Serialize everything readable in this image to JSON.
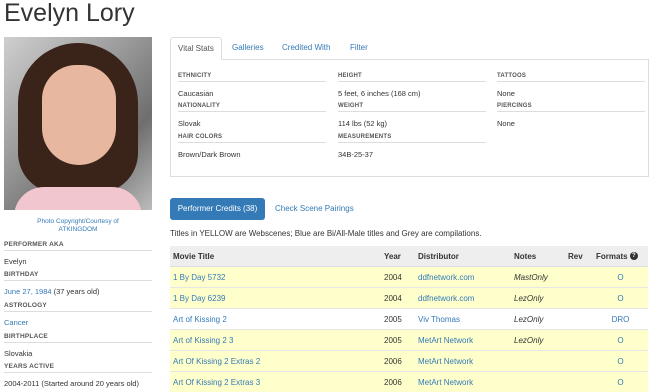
{
  "performer": {
    "name": "Evelyn Lory",
    "photo_credit_line1": "Photo Copyright/Courtesy of",
    "photo_credit_line2": "ATKINGDOM"
  },
  "sidebar": {
    "aka_label": "PERFORMER AKA",
    "aka_value": "Evelyn",
    "birthday_label": "BIRTHDAY",
    "birthday_date": "June 27, 1984",
    "birthday_age": " (37 years old)",
    "astrology_label": "ASTROLOGY",
    "astrology_value": "Cancer",
    "birthplace_label": "BIRTHPLACE",
    "birthplace_value": "Slovakia",
    "years_label": "YEARS ACTIVE",
    "years_value": "2004-2011 (Started around 20 years old)"
  },
  "tabs": [
    "Vital Stats",
    "Galleries",
    "Credited With",
    "Filter"
  ],
  "stats": {
    "ethnicity_label": "ETHNICITY",
    "ethnicity": "Caucasian",
    "nationality_label": "NATIONALITY",
    "nationality": "Slovak",
    "hair_label": "HAIR COLORS",
    "hair": "Brown/Dark Brown",
    "height_label": "HEIGHT",
    "height": "5 feet, 6 inches (168 cm)",
    "weight_label": "WEIGHT",
    "weight": "114 lbs (52 kg)",
    "measurements_label": "MEASUREMENTS",
    "measurements": "34B-25-37",
    "tattoos_label": "TATTOOS",
    "tattoos": "None",
    "piercings_label": "PIERCINGS",
    "piercings": "None"
  },
  "credits": {
    "button_label": "Performer Credits (38)",
    "pairings_link": "Check Scene Pairings",
    "legend": "Titles in YELLOW are Webscenes; Blue are Bi/All-Male titles and Grey are compilations.",
    "columns": [
      "Movie Title",
      "Year",
      "Distributor",
      "Notes",
      "Rev",
      "Formats"
    ],
    "rows": [
      {
        "title": "1 By Day 5732",
        "year": "2004",
        "distributor": "ddfnetwork.com",
        "notes": "MastOnly",
        "rev": "",
        "formats": "O",
        "webscene": true
      },
      {
        "title": "1 By Day 6239",
        "year": "2004",
        "distributor": "ddfnetwork.com",
        "notes": "LezOnly",
        "rev": "",
        "formats": "O",
        "webscene": true
      },
      {
        "title": "Art of Kissing 2",
        "year": "2005",
        "distributor": "Viv Thomas",
        "notes": "LezOnly",
        "rev": "",
        "formats": "DRO",
        "webscene": false
      },
      {
        "title": "Art of Kissing 2 3",
        "year": "2005",
        "distributor": "MetArt Network",
        "notes": "LezOnly",
        "rev": "",
        "formats": "O",
        "webscene": true
      },
      {
        "title": "Art Of Kissing 2 Extras 2",
        "year": "2006",
        "distributor": "MetArt Network",
        "notes": "",
        "rev": "",
        "formats": "O",
        "webscene": true
      },
      {
        "title": "Art Of Kissing 2 Extras 3",
        "year": "2006",
        "distributor": "MetArt Network",
        "notes": "",
        "rev": "",
        "formats": "O",
        "webscene": true
      }
    ]
  },
  "colors": {
    "link": "#337ab7",
    "webscene_row": "#ffffcc",
    "button": "#337ab7"
  }
}
